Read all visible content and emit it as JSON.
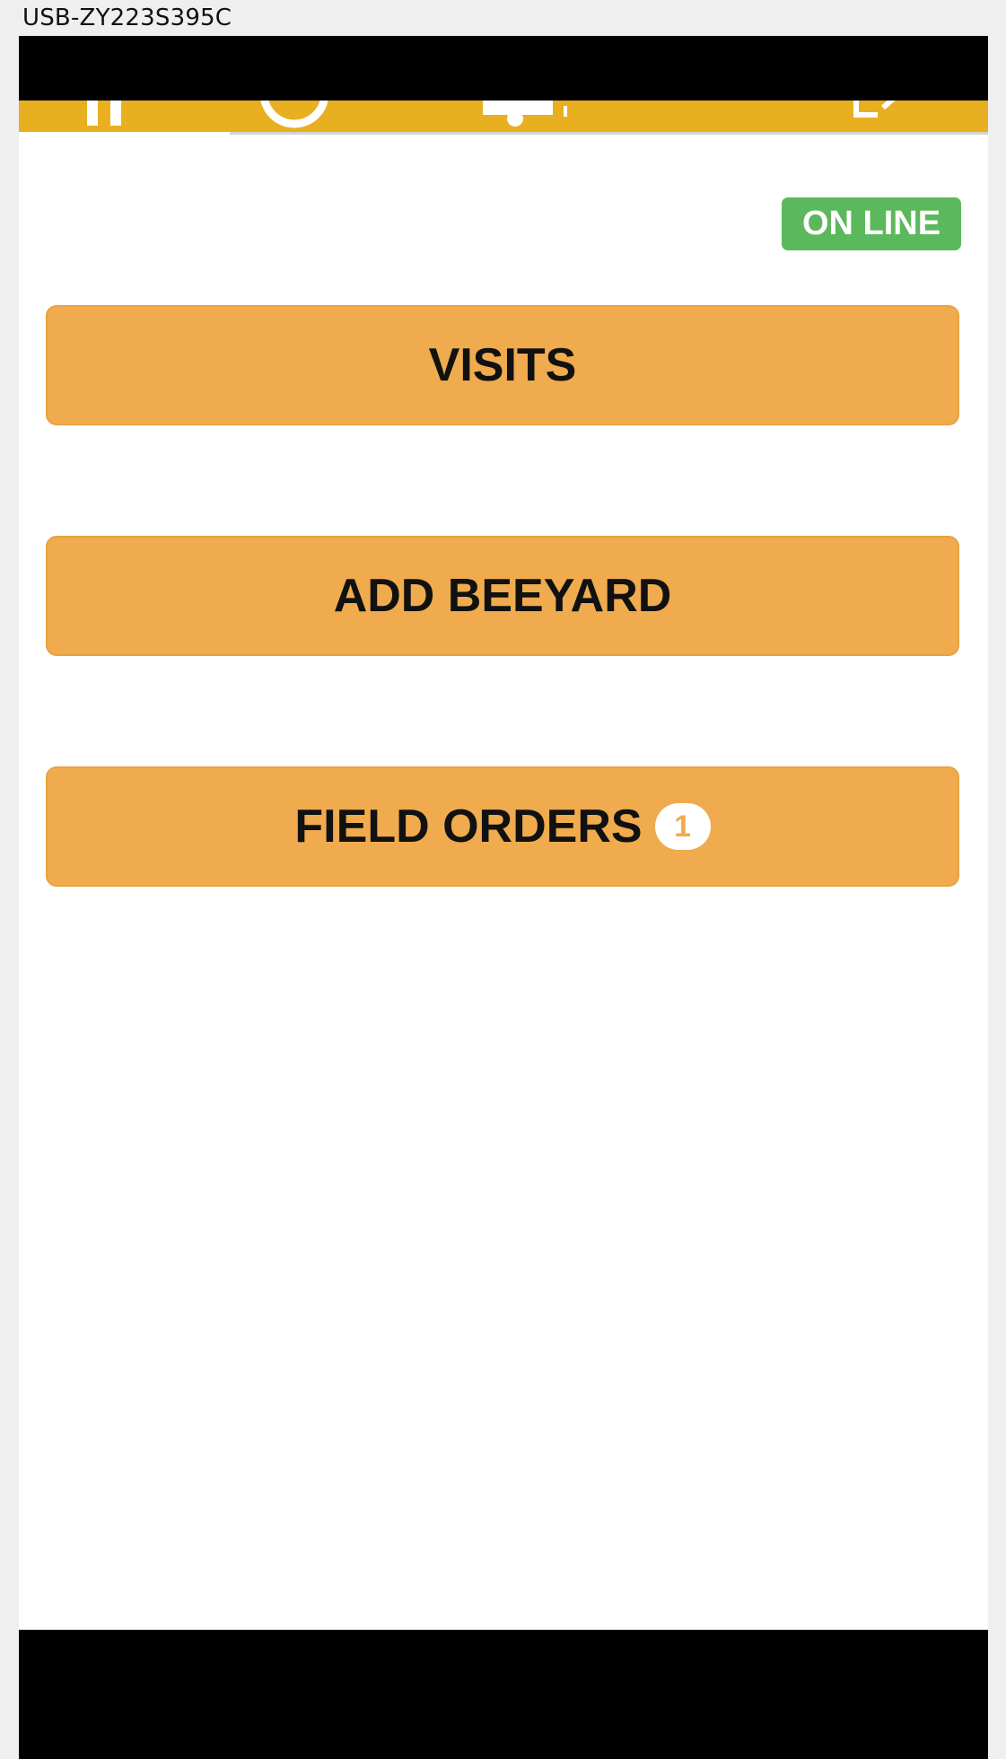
{
  "window": {
    "title": "USB-ZY223S395C"
  },
  "tabs": [
    {
      "name": "home",
      "icon": "home-icon",
      "active": true
    },
    {
      "name": "tab-2",
      "icon": "circle-icon",
      "active": false
    },
    {
      "name": "tab-3",
      "icon": "truck-icon",
      "active": false
    },
    {
      "name": "tab-4",
      "icon": "logout-icon",
      "active": false
    }
  ],
  "status": {
    "label": "ON LINE",
    "color": "#5cb85c"
  },
  "buttons": {
    "visits_label": "VISITS",
    "add_beeyard_label": "ADD BEEYARD",
    "field_orders_label": "FIELD ORDERS",
    "field_orders_count": "1"
  },
  "colors": {
    "accent": "#e8b021",
    "button": "#efab4e",
    "online": "#5cb85c"
  }
}
